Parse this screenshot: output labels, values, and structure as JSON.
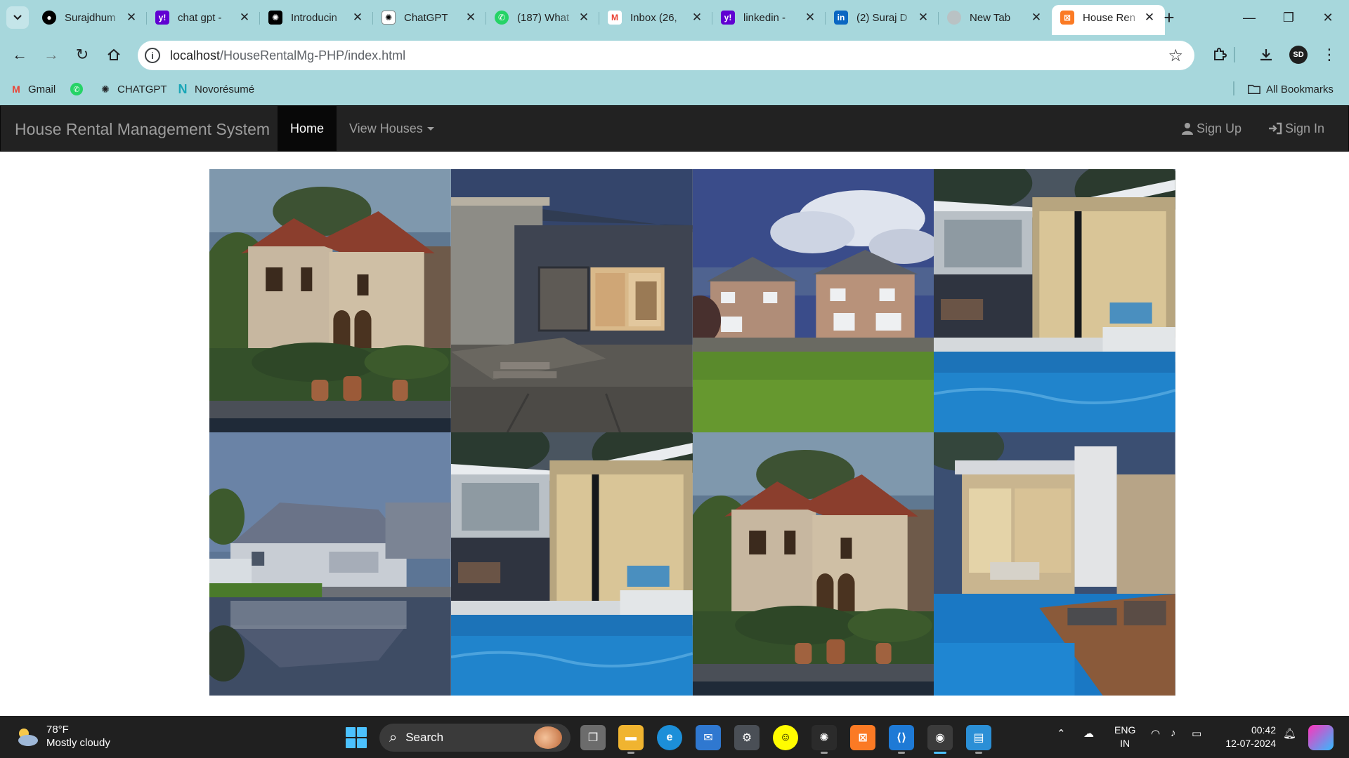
{
  "browser": {
    "tabs": [
      {
        "title": "Surajdhum",
        "icon": "github-icon",
        "color": "#000000"
      },
      {
        "title": "chat gpt -",
        "icon": "yahoo-icon",
        "color": "#6001d2"
      },
      {
        "title": "Introducin",
        "icon": "openai-icon",
        "color": "#000000"
      },
      {
        "title": "ChatGPT",
        "icon": "openai-icon",
        "color": "#ffffff"
      },
      {
        "title": "(187) What",
        "icon": "whatsapp-icon",
        "color": "#25d366"
      },
      {
        "title": "Inbox (26,",
        "icon": "gmail-icon",
        "color": "#ea4335"
      },
      {
        "title": "linkedin -",
        "icon": "yahoo-icon",
        "color": "#6001d2"
      },
      {
        "title": "(2) Suraj D",
        "icon": "linkedin-icon",
        "color": "#0a66c2"
      },
      {
        "title": "New Tab",
        "icon": "chrome-icon",
        "color": "#9aa0a6"
      },
      {
        "title": "House Ren",
        "icon": "xampp-icon",
        "color": "#fb7a24"
      }
    ],
    "url_host": "localhost",
    "url_path": "/HouseRentalMg-PHP/index.html",
    "bookmarks": [
      {
        "label": "Gmail",
        "icon": "gmail-icon"
      },
      {
        "label": "",
        "icon": "whatsapp-icon"
      },
      {
        "label": "CHATGPT",
        "icon": "openai-icon"
      },
      {
        "label": "Novorésumé",
        "icon": "novoresume-icon"
      }
    ],
    "all_bookmarks": "All Bookmarks"
  },
  "navbar": {
    "brand": "House Rental Management System",
    "home": "Home",
    "view_houses": "View Houses",
    "sign_up": "Sign Up",
    "sign_in": "Sign In"
  },
  "gallery": {
    "images": [
      "mediterranean-villa",
      "modern-stone-house-dusk",
      "twin-brick-houses-lawn",
      "modern-house-pool",
      "lakeside-white-house",
      "modern-house-pool",
      "mediterranean-villa",
      "luxury-pool-deck"
    ]
  },
  "taskbar": {
    "temperature": "78°F",
    "weather": "Mostly cloudy",
    "search": "Search",
    "lang_top": "ENG",
    "lang_bottom": "IN",
    "time": "00:42",
    "date": "12-07-2024"
  }
}
